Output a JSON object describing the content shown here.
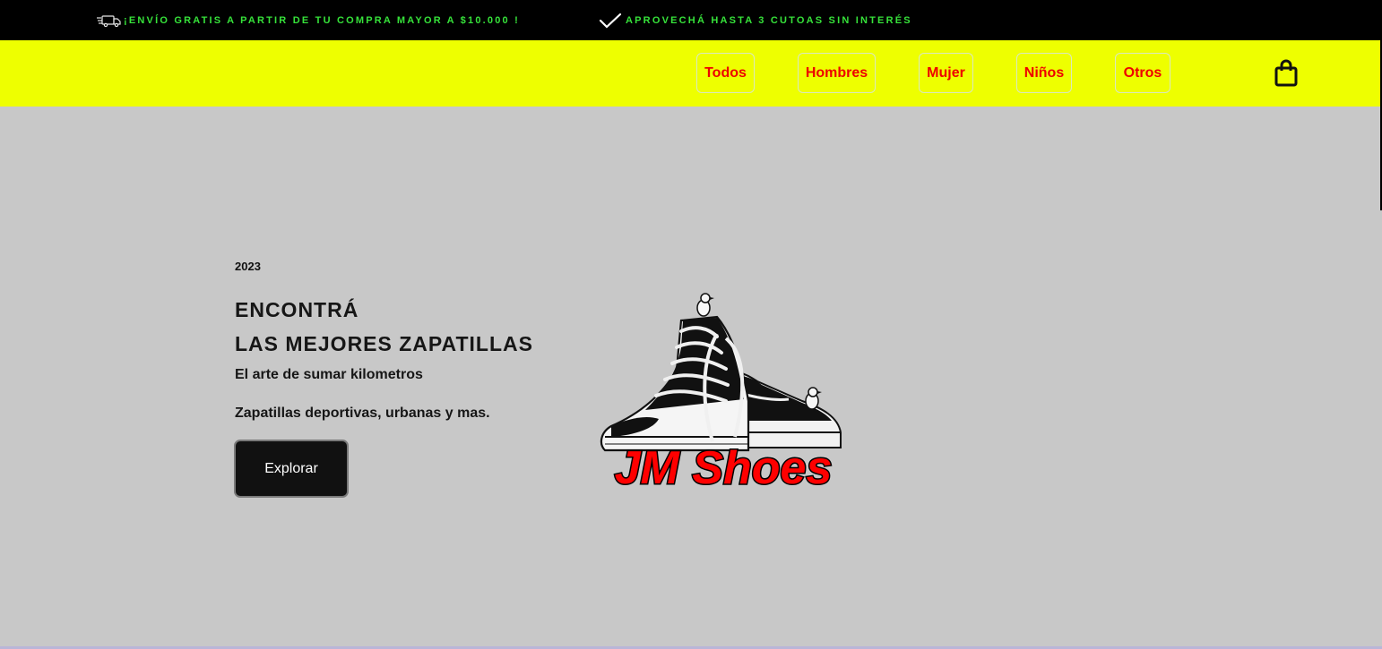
{
  "promo_bar": {
    "shipping_text": "¡ENVÍO GRATIS A PARTIR DE TU COMPRA MAYOR A $10.000 !",
    "installments_text": "APROVECHÁ HASTA 3 CUTOAS SIN INTERÉS",
    "shipping_icon": "truck-icon",
    "installments_icon": "check-icon",
    "text_color": "#36e23a"
  },
  "nav": {
    "links": [
      {
        "label": "Todos"
      },
      {
        "label": "Hombres"
      },
      {
        "label": "Mujer"
      },
      {
        "label": "Niños"
      },
      {
        "label": "Otros"
      }
    ],
    "cart_icon": "shopping-bag-icon",
    "background": "#eeff00",
    "link_color": "#ee0000"
  },
  "hero": {
    "year": "2023",
    "title_line1": "ENCONTRÁ",
    "title_line2": "LAS MEJORES ZAPATILLAS",
    "subtitle": "El arte de sumar kilometros",
    "description": "Zapatillas deportivas, urbanas y mas.",
    "cta_label": "Explorar",
    "background": "#c8c8c8"
  },
  "logo": {
    "text": "JM Shoes",
    "text_color": "#ff0000",
    "image": "sneakers-with-birds-illustration"
  }
}
